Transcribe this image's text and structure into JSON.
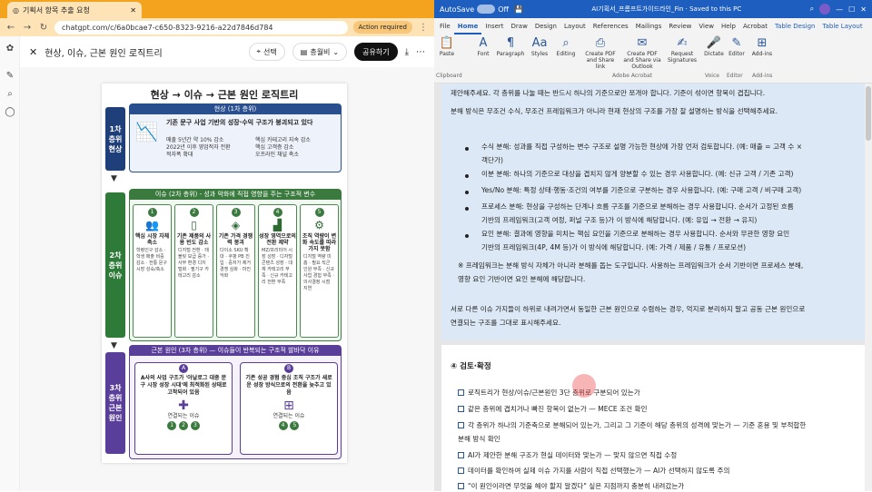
{
  "browser": {
    "tab_title": "기획서 항목 추출 요청",
    "url": "chatgpt.com/c/6a0bcae7-c650-8323-9216-a22d7846d784",
    "action_required": "Action required",
    "accent": "#f4a31e"
  },
  "canvas": {
    "title": "현상, 이슈, 근본 원인 로직트리",
    "select_label": "선택",
    "hint_label": "총월비",
    "share_label": "공유하기"
  },
  "logic_tree": {
    "title": "현상 → 이슈 → 근본 원인 로직트리",
    "level1": "1차 층위 현상",
    "level2": "2차 층위 이슈",
    "level3": "3차 층위 근본 원인",
    "phenomenon_head": "현상 (1차 층위)",
    "phenomenon_main": "기존 문구 사업 기반의 성장·수익 구조가 붕괴되고 있다",
    "phenomenon_points": [
      "매출 5년간 약 10% 감소",
      "핵심 카테고리 지속 감소",
      "2022년 이후 영업적자 전환",
      "핵심 고객층 감소",
      "적자폭 확대",
      "오프라인 채널 축소"
    ],
    "issue_head": "이슈 (2차 층위) - 성과 악화에 직접 영향을 주는 구조적 변수",
    "issues": [
      {
        "n": "1",
        "title": "핵심 시장 자체 축소",
        "body": "학령인구 감소 · 학생 매출 비중 감소 · 전통 문구 시장 성숙/축소"
      },
      {
        "n": "2",
        "title": "기존 제품의 사용 빈도 감소",
        "body": "디지털 전환 · 태블릿 보급 증가 · 사무 환경 디지털화 · 필기구 카테고리 감소"
      },
      {
        "n": "3",
        "title": "기존 가격 경쟁력 붕괴",
        "body": "다이소 SKU 확대 · 쿠팡 PB 진입 · 중저가 제거 경쟁 심화 · 마진 악화"
      },
      {
        "n": "4",
        "title": "성장 영역으로의 전환 제약",
        "body": "MZ/프리미어 시장 성장 · 디자털 콘텐츠 성장 · 대체 카테고리 부족 · 신규 카테고리 전환 부족"
      },
      {
        "n": "5",
        "title": "조직 역량이 변화 속도를 따라가지 못함",
        "body": "디지털 역량 미흡 · 필요 직군 인원 부족 · 신규 사업 경험 부족 · 의사결정 시점 지연"
      }
    ],
    "root_head": "근본 원인 (3차 층위) — 이슈들이 반복되는 구조적 발바닥 이유",
    "root_a_label": "A",
    "root_a": "A사의 사업 구조가 '아날로그 대중 문구 시장 성장 시대'에 최적화된 상태로 고착되어 있음",
    "root_b_label": "B",
    "root_b": "기존 성공 경험 중심 조직 구조가 새로운 성장 방식으로의 전환을 늦추고 있음",
    "root_link_label": "연결되는 이슈",
    "root_a_links": [
      "1",
      "2",
      "3"
    ],
    "root_b_links": [
      "4",
      "5"
    ]
  },
  "word": {
    "autosave": "AutoSave",
    "toggle": "Off",
    "doc_title": "AI기획서_프롬프트가이드라인_Fin · Saved to this PC",
    "tabs": [
      "File",
      "Home",
      "Insert",
      "Draw",
      "Design",
      "Layout",
      "References",
      "Mailings",
      "Review",
      "View",
      "Help",
      "Acrobat",
      "Table Design",
      "Table Layout"
    ],
    "ribbon_groups": [
      "Paste",
      "Font",
      "Paragraph",
      "Styles",
      "Editing",
      "Create PDF and Share link",
      "Create PDF and Share via Outlook",
      "Request Signatures",
      "Dictate",
      "Editor",
      "Add-ins"
    ],
    "ribbon_labels": [
      "Clipboard",
      "Adobe Acrobat",
      "Voice",
      "Editor",
      "Add-ins"
    ],
    "lines_top": [
      "제안해주세요. 각 층위를 나눌 때는 반드시 하나의 기준으로만 쪼개야 합니다. 기준이 섞이면 항목이 겹칩니다.",
      "분해 방식은 무조건 수식, 무조건 프레임워크가 아니라 현재 현상의 구조를 가장 잘 설명하는 방식을 선택해주세요."
    ],
    "bullets": [
      "수식 분해: 성과를 직접 구성하는 변수 구조로 설명 가능한 현상에 가장 먼저 검토합니다. (예: 매출 = 고객 수 ×",
      "이분 분해: 하나의 기준으로 대상을 겹치지 않게 양분할 수 있는 경우 사용합니다. (예: 신규 고객 / 기존 고객)",
      "Yes/No 분해: 특정 상태·행동·조건의 여부를 기준으로 구분하는 경우 사용합니다. (예: 구매 고객 / 비구매 고객)",
      "프로세스 분해: 현상을 구성하는 단계나 흐름 구조를 기준으로 분해하는 경우 사용합니다. 순서가 고정된 흐름",
      "요인 분해: 결과에 영향을 미치는 핵심 요인을 기준으로 분해하는 경우 사용합니다. 순서와 무관한 영향 요인"
    ],
    "bullet_cont": [
      "객단가)",
      "기반의 프레임워크(고객 여정, 퍼널 구조 등)가 이 방식에 해당합니다. (예: 유입 → 전환 → 유지)",
      "기반의 프레임워크(4P, 4M 등)가 이 방식에 해당합니다. (예: 가격 / 제품 / 유통 / 프로모션)"
    ],
    "note": [
      "※ 프레임워크는 분해 방식 자체가 아니라 분해를 돕는 도구입니다. 사용하는 프레임워크가 순서 기반이면 프로세스 분해,",
      "영향 요인 기반이면 요인 분해에 해당합니다."
    ],
    "para": [
      "서로 다른 이슈 가지들이 하위로 내려가면서 동일한 근본 원인으로 수렴하는 경우, 억지로 분리하지 말고 공동 근본 원인으로",
      "연결되는 구조를 그대로 표시해주세요."
    ],
    "section": "④ 검토·확정",
    "checks": [
      "로직트리가 현상/이슈/근본원인 3단 층위로 구분되어 있는가",
      "같은 층위에 겹치거나 빠진 항목이 없는가 — MECE 조건 확인",
      "각 층위가 하나의 기준축으로 분해되어 있는가, 그리고 그 기준이 해당 층위의 성격에 맞는가 — 기준 혼용 및 부적합한",
      "AI가 제안한 분해 구조가 현실 데이터와 맞는가 — 맞지 않으면 직접 수정",
      "데이터를 확인하여 실제 이슈 가지를 사람이 직접 선택했는가 — AI가 선택하지 않도록 주의",
      "\"이 원인이라면 무엇을 해야 할지 알겠다\" 싶은 지점까지 충분히 내려갔는가"
    ],
    "check_cont": "분해 방식 확인"
  }
}
